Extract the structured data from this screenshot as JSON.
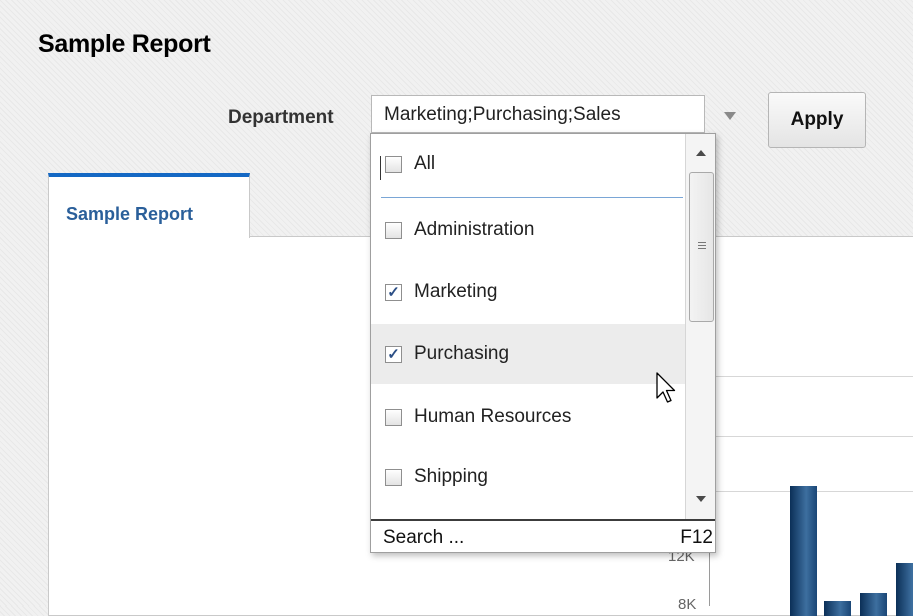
{
  "page": {
    "title": "Sample Report"
  },
  "filter": {
    "label": "Department",
    "selected_value": "Marketing;Purchasing;Sales",
    "apply_label": "Apply"
  },
  "tabs": [
    {
      "label": "Sample Report",
      "active": true
    }
  ],
  "dropdown": {
    "items": [
      {
        "label": "All",
        "checked": false
      },
      {
        "label": "Administration",
        "checked": false
      },
      {
        "label": "Marketing",
        "checked": true
      },
      {
        "label": "Purchasing",
        "checked": true,
        "hovered": true
      },
      {
        "label": "Human Resources",
        "checked": false
      },
      {
        "label": "Shipping",
        "checked": false
      }
    ],
    "search_label": "Search ...",
    "search_shortcut": "F12"
  },
  "chart": {
    "tick_labels": [
      "12K",
      "8K"
    ]
  },
  "colors": {
    "accent": "#1468c4",
    "tab_label": "#2a5f9a",
    "check": "#2c4f86",
    "bar": "#1a4676"
  },
  "icons": {
    "cursor": "mouse-pointer-icon",
    "dropdown_arrow": "triangle-down-icon"
  }
}
